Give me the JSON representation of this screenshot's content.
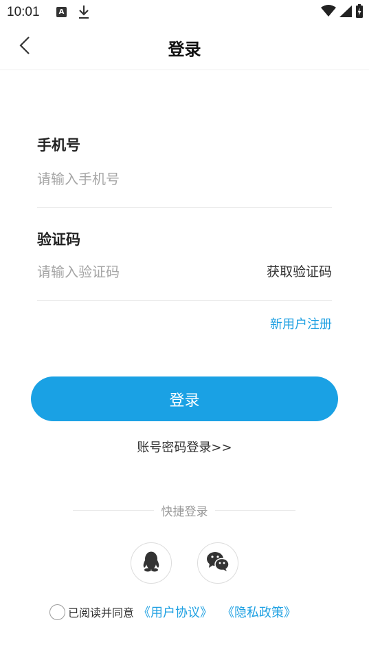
{
  "status_bar": {
    "time": "10:01",
    "notification_icon_letter": "A"
  },
  "header": {
    "title": "登录"
  },
  "form": {
    "phone_label": "手机号",
    "phone_placeholder": "请输入手机号",
    "phone_value": "",
    "code_label": "验证码",
    "code_placeholder": "请输入验证码",
    "code_value": "",
    "get_code_label": "获取验证码",
    "register_label": "新用户注册"
  },
  "actions": {
    "login_label": "登录",
    "password_login_label": "账号密码登录>>"
  },
  "quick_login": {
    "title": "快捷登录",
    "providers": [
      "qq-icon",
      "wechat-icon"
    ]
  },
  "agreement": {
    "checked": false,
    "text": "已阅读并同意",
    "user_agreement": "《用户协议》",
    "privacy_policy": "《隐私政策》"
  },
  "colors": {
    "accent": "#1aa1e4",
    "link": "#1ea0e2",
    "placeholder": "#a6a6a6",
    "divider": "#ececec"
  }
}
